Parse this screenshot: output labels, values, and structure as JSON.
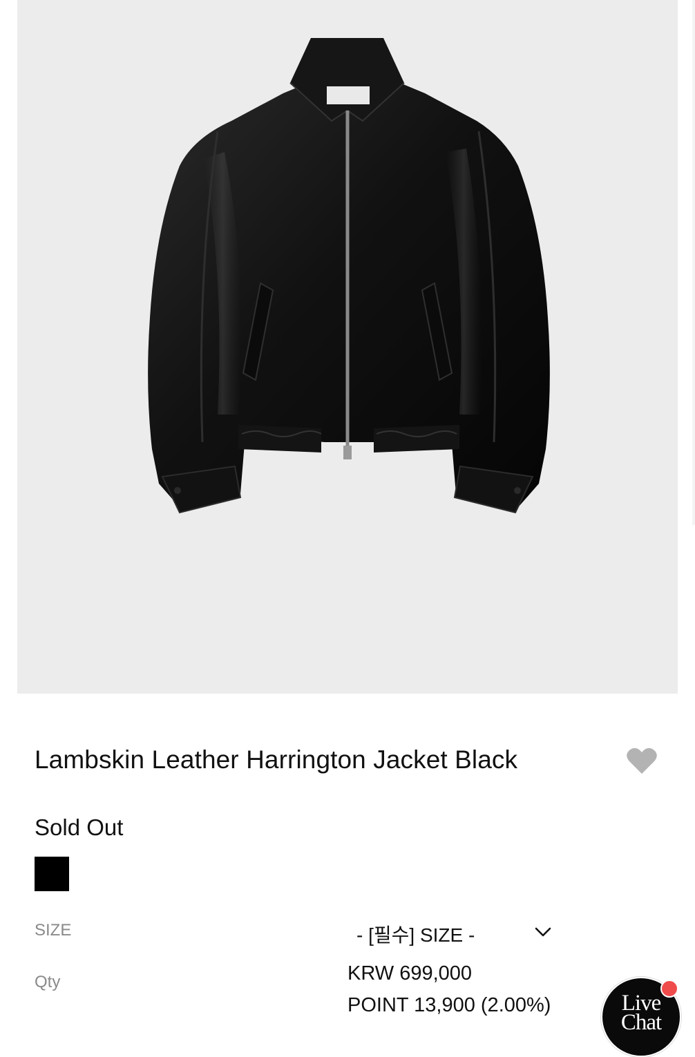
{
  "product": {
    "image_alt": "Lambskin Leather Harrington Jacket Black",
    "title": "Lambskin Leather Harrington Jacket Black",
    "status": "Sold Out",
    "swatch_color": "#000000"
  },
  "options": {
    "size_label": "SIZE",
    "size_value": "- [필수] SIZE -",
    "qty_label": "Qty"
  },
  "pricing": {
    "price": "KRW 699,000",
    "points": "POINT 13,900 (2.00%)"
  },
  "live_chat": {
    "label_line1": "Live",
    "label_line2": "Chat"
  },
  "icons": {
    "wishlist": "heart-icon",
    "dropdown": "chevron-down-icon"
  },
  "colors": {
    "image_bg": "#ececec",
    "heart": "#b3b3b3",
    "muted_text": "#8a8a8a",
    "chat_badge": "#ef4b4b"
  }
}
